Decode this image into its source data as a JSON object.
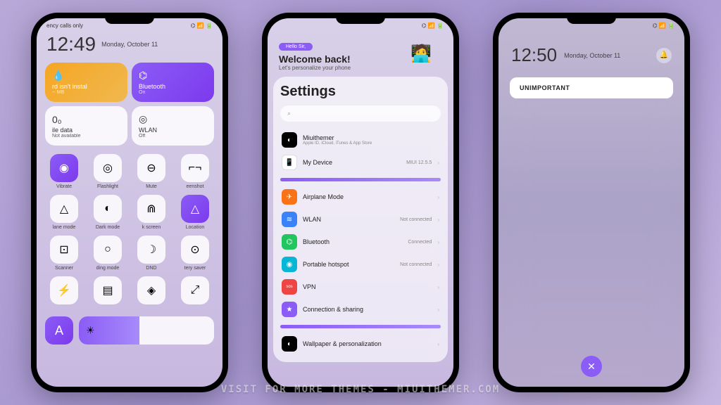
{
  "phone1": {
    "status_left": "ency calls only",
    "clock": "12:49",
    "date": "Monday, October 11",
    "tiles": {
      "orange": {
        "title": "rd isn't instal",
        "sub": "-- MB"
      },
      "bluetooth": {
        "title": "Bluetooth",
        "sub": "On"
      },
      "data": {
        "title": "ile data",
        "sub": "Not available"
      },
      "wlan": {
        "title": "WLAN",
        "sub": "Off"
      }
    },
    "toggles": [
      {
        "label": "Vibrate",
        "icon": "◉",
        "active": true
      },
      {
        "label": "Flashlight",
        "icon": "◎",
        "active": false
      },
      {
        "label": "Mute",
        "icon": "⊖",
        "active": false
      },
      {
        "label": "eenshot",
        "icon": "⌐¬",
        "active": false
      },
      {
        "label": "lane mode",
        "icon": "△",
        "active": false
      },
      {
        "label": "Dark mode",
        "icon": "◐",
        "active": false
      },
      {
        "label": "k screen",
        "icon": "⋒",
        "active": false
      },
      {
        "label": "Location",
        "icon": "△",
        "active": true
      },
      {
        "label": "Scanner",
        "icon": "⊡",
        "active": false
      },
      {
        "label": "ding mode",
        "icon": "○",
        "active": false
      },
      {
        "label": "DND",
        "icon": "☽",
        "active": false
      },
      {
        "label": "tery saver",
        "icon": "⊙",
        "active": false
      },
      {
        "label": "",
        "icon": "⚡",
        "active": false
      },
      {
        "label": "",
        "icon": "▤",
        "active": false
      },
      {
        "label": "",
        "icon": "◈",
        "active": false
      },
      {
        "label": "",
        "icon": "⤢",
        "active": false
      }
    ]
  },
  "phone2": {
    "hello": "Hello Sir,",
    "welcome": "Welcome back!",
    "welcome_sub": "Let's personalize your phone",
    "title": "Settings",
    "search_placeholder": "⌕",
    "account": {
      "name": "Miuithemer",
      "sub": "Apple ID, iCloud, iTunes & App Store"
    },
    "items": [
      {
        "name": "My Device",
        "status": "MIUI 12.5.5",
        "icon": "📱",
        "cls": "iwh"
      },
      {
        "name": "Airplane Mode",
        "status": "",
        "icon": "✈",
        "cls": "ior"
      },
      {
        "name": "WLAN",
        "status": "Not connected",
        "icon": "≋",
        "cls": "ibl"
      },
      {
        "name": "Bluetooth",
        "status": "Connected",
        "icon": "⌬",
        "cls": "igr"
      },
      {
        "name": "Portable hotspot",
        "status": "Not connected",
        "icon": "◉",
        "cls": "icy"
      },
      {
        "name": "VPN",
        "status": "",
        "icon": "sos",
        "cls": "ird"
      },
      {
        "name": "Connection & sharing",
        "status": "",
        "icon": "★",
        "cls": "ipu"
      },
      {
        "name": "Wallpaper & personalization",
        "status": "",
        "icon": "◐",
        "cls": "ibk"
      }
    ]
  },
  "phone3": {
    "clock": "12:50",
    "date": "Monday, October 11",
    "notif": "UNIMPORTANT"
  },
  "watermark": "VISIT FOR MORE THEMES - MIUITHEMER.COM"
}
